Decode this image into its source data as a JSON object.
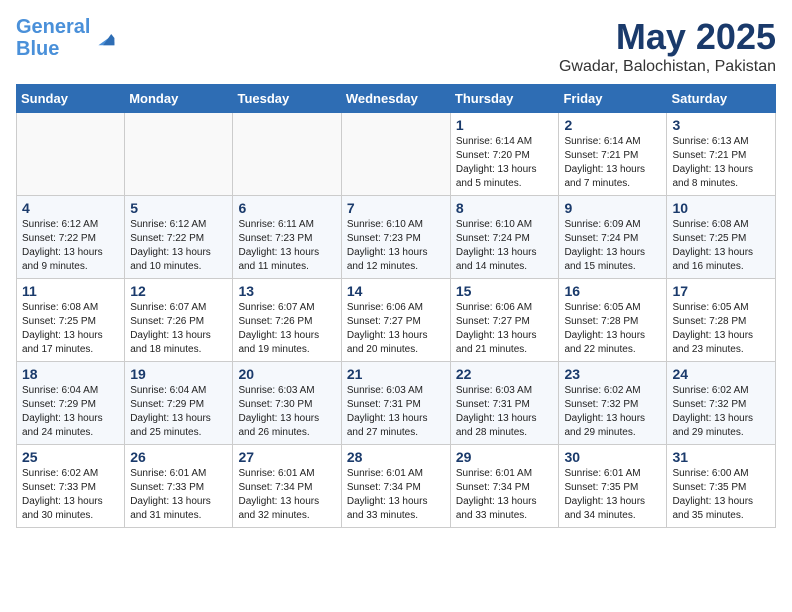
{
  "header": {
    "logo_line1": "General",
    "logo_line2": "Blue",
    "month_title": "May 2025",
    "location": "Gwadar, Balochistan, Pakistan"
  },
  "days_of_week": [
    "Sunday",
    "Monday",
    "Tuesday",
    "Wednesday",
    "Thursday",
    "Friday",
    "Saturday"
  ],
  "weeks": [
    [
      {
        "day": "",
        "info": ""
      },
      {
        "day": "",
        "info": ""
      },
      {
        "day": "",
        "info": ""
      },
      {
        "day": "",
        "info": ""
      },
      {
        "day": "1",
        "info": "Sunrise: 6:14 AM\nSunset: 7:20 PM\nDaylight: 13 hours and 5 minutes."
      },
      {
        "day": "2",
        "info": "Sunrise: 6:14 AM\nSunset: 7:21 PM\nDaylight: 13 hours and 7 minutes."
      },
      {
        "day": "3",
        "info": "Sunrise: 6:13 AM\nSunset: 7:21 PM\nDaylight: 13 hours and 8 minutes."
      }
    ],
    [
      {
        "day": "4",
        "info": "Sunrise: 6:12 AM\nSunset: 7:22 PM\nDaylight: 13 hours and 9 minutes."
      },
      {
        "day": "5",
        "info": "Sunrise: 6:12 AM\nSunset: 7:22 PM\nDaylight: 13 hours and 10 minutes."
      },
      {
        "day": "6",
        "info": "Sunrise: 6:11 AM\nSunset: 7:23 PM\nDaylight: 13 hours and 11 minutes."
      },
      {
        "day": "7",
        "info": "Sunrise: 6:10 AM\nSunset: 7:23 PM\nDaylight: 13 hours and 12 minutes."
      },
      {
        "day": "8",
        "info": "Sunrise: 6:10 AM\nSunset: 7:24 PM\nDaylight: 13 hours and 14 minutes."
      },
      {
        "day": "9",
        "info": "Sunrise: 6:09 AM\nSunset: 7:24 PM\nDaylight: 13 hours and 15 minutes."
      },
      {
        "day": "10",
        "info": "Sunrise: 6:08 AM\nSunset: 7:25 PM\nDaylight: 13 hours and 16 minutes."
      }
    ],
    [
      {
        "day": "11",
        "info": "Sunrise: 6:08 AM\nSunset: 7:25 PM\nDaylight: 13 hours and 17 minutes."
      },
      {
        "day": "12",
        "info": "Sunrise: 6:07 AM\nSunset: 7:26 PM\nDaylight: 13 hours and 18 minutes."
      },
      {
        "day": "13",
        "info": "Sunrise: 6:07 AM\nSunset: 7:26 PM\nDaylight: 13 hours and 19 minutes."
      },
      {
        "day": "14",
        "info": "Sunrise: 6:06 AM\nSunset: 7:27 PM\nDaylight: 13 hours and 20 minutes."
      },
      {
        "day": "15",
        "info": "Sunrise: 6:06 AM\nSunset: 7:27 PM\nDaylight: 13 hours and 21 minutes."
      },
      {
        "day": "16",
        "info": "Sunrise: 6:05 AM\nSunset: 7:28 PM\nDaylight: 13 hours and 22 minutes."
      },
      {
        "day": "17",
        "info": "Sunrise: 6:05 AM\nSunset: 7:28 PM\nDaylight: 13 hours and 23 minutes."
      }
    ],
    [
      {
        "day": "18",
        "info": "Sunrise: 6:04 AM\nSunset: 7:29 PM\nDaylight: 13 hours and 24 minutes."
      },
      {
        "day": "19",
        "info": "Sunrise: 6:04 AM\nSunset: 7:29 PM\nDaylight: 13 hours and 25 minutes."
      },
      {
        "day": "20",
        "info": "Sunrise: 6:03 AM\nSunset: 7:30 PM\nDaylight: 13 hours and 26 minutes."
      },
      {
        "day": "21",
        "info": "Sunrise: 6:03 AM\nSunset: 7:31 PM\nDaylight: 13 hours and 27 minutes."
      },
      {
        "day": "22",
        "info": "Sunrise: 6:03 AM\nSunset: 7:31 PM\nDaylight: 13 hours and 28 minutes."
      },
      {
        "day": "23",
        "info": "Sunrise: 6:02 AM\nSunset: 7:32 PM\nDaylight: 13 hours and 29 minutes."
      },
      {
        "day": "24",
        "info": "Sunrise: 6:02 AM\nSunset: 7:32 PM\nDaylight: 13 hours and 29 minutes."
      }
    ],
    [
      {
        "day": "25",
        "info": "Sunrise: 6:02 AM\nSunset: 7:33 PM\nDaylight: 13 hours and 30 minutes."
      },
      {
        "day": "26",
        "info": "Sunrise: 6:01 AM\nSunset: 7:33 PM\nDaylight: 13 hours and 31 minutes."
      },
      {
        "day": "27",
        "info": "Sunrise: 6:01 AM\nSunset: 7:34 PM\nDaylight: 13 hours and 32 minutes."
      },
      {
        "day": "28",
        "info": "Sunrise: 6:01 AM\nSunset: 7:34 PM\nDaylight: 13 hours and 33 minutes."
      },
      {
        "day": "29",
        "info": "Sunrise: 6:01 AM\nSunset: 7:34 PM\nDaylight: 13 hours and 33 minutes."
      },
      {
        "day": "30",
        "info": "Sunrise: 6:01 AM\nSunset: 7:35 PM\nDaylight: 13 hours and 34 minutes."
      },
      {
        "day": "31",
        "info": "Sunrise: 6:00 AM\nSunset: 7:35 PM\nDaylight: 13 hours and 35 minutes."
      }
    ]
  ]
}
